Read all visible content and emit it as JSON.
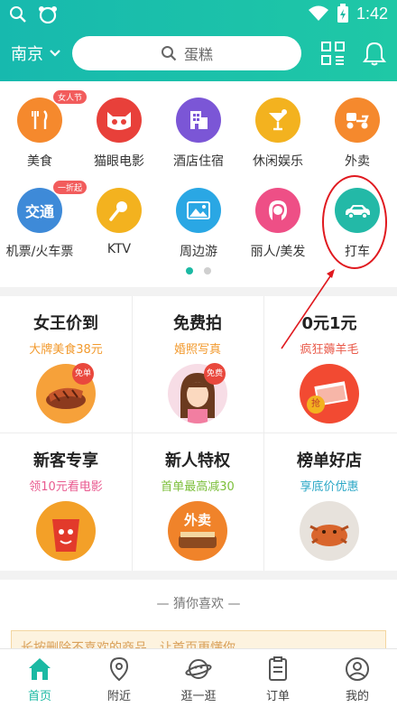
{
  "status_bar": {
    "time": "1:42"
  },
  "header": {
    "city": "南京",
    "search_placeholder": "蛋糕"
  },
  "categories": [
    {
      "label": "美食",
      "badge": "女人节",
      "icon": "fork-knife-icon",
      "color": "#f5892d"
    },
    {
      "label": "猫眼电影",
      "badge": "",
      "icon": "cat-face-icon",
      "color": "#e8403a"
    },
    {
      "label": "酒店住宿",
      "badge": "",
      "icon": "building-icon",
      "color": "#7b56d6"
    },
    {
      "label": "休闲娱乐",
      "badge": "",
      "icon": "cocktail-icon",
      "color": "#f3b21f"
    },
    {
      "label": "外卖",
      "badge": "",
      "icon": "scooter-icon",
      "color": "#f5892d"
    },
    {
      "label": "机票/火车票",
      "badge": "一折起",
      "icon": "transport-text-icon",
      "icon_text": "交通",
      "color": "#3e8ad8"
    },
    {
      "label": "KTV",
      "badge": "",
      "icon": "microphone-icon",
      "color": "#f3b21f"
    },
    {
      "label": "周边游",
      "badge": "",
      "icon": "landscape-icon",
      "color": "#2aa7e4"
    },
    {
      "label": "丽人/美发",
      "badge": "",
      "icon": "woman-hair-icon",
      "color": "#ee4f86"
    },
    {
      "label": "打车",
      "badge": "",
      "icon": "car-icon",
      "color": "#23b9a7"
    }
  ],
  "pager": {
    "pages": 2,
    "current": 1
  },
  "promos": [
    {
      "title": "女王价到",
      "subtitle": "大牌美食38元",
      "subtitle_color": "#f29a2e",
      "image": "steak-image",
      "sticker": "免单"
    },
    {
      "title": "免费拍",
      "subtitle": "婚照写真",
      "subtitle_color": "#f29a2e",
      "image": "girl-portrait-image",
      "sticker": "免费"
    },
    {
      "title": "0元1元",
      "subtitle": "疯狂薅羊毛",
      "subtitle_color": "#e95a4a",
      "image": "red-envelope-image",
      "sticker": "抢"
    },
    {
      "title": "新客专享",
      "subtitle": "领10元看电影",
      "subtitle_color": "#e95a8f",
      "image": "popcorn-image",
      "sticker": ""
    },
    {
      "title": "新人特权",
      "subtitle": "首单最高减30",
      "subtitle_color": "#7cbf3a",
      "image": "takeout-image",
      "sticker": "外卖"
    },
    {
      "title": "榜单好店",
      "subtitle": "享底价优惠",
      "subtitle_color": "#2aa7c6",
      "image": "crab-image",
      "sticker": ""
    }
  ],
  "guess": {
    "title": "— 猜你喜欢 —",
    "hint": "长按删除不喜欢的商品，让首页更懂你"
  },
  "tabs": [
    {
      "label": "首页",
      "icon": "home-icon",
      "active": true
    },
    {
      "label": "附近",
      "icon": "location-pin-icon",
      "active": false
    },
    {
      "label": "逛一逛",
      "icon": "planet-icon",
      "active": false
    },
    {
      "label": "订单",
      "icon": "order-list-icon",
      "active": false
    },
    {
      "label": "我的",
      "icon": "profile-icon",
      "active": false
    }
  ],
  "colors": {
    "brand": "#1bb9a3",
    "annotation": "#e0191f"
  }
}
